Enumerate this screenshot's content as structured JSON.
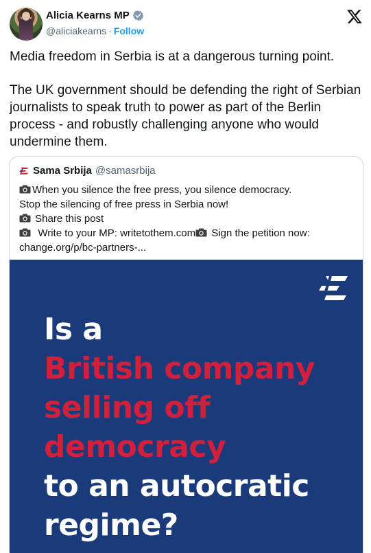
{
  "author": {
    "name": "Alicia Kearns MP",
    "handle": "@aliciakearns",
    "separator": "·",
    "follow_label": "Follow"
  },
  "platform": {
    "logo_icon": "x-logo-icon"
  },
  "tweet": {
    "paragraphs": [
      "Media freedom in Serbia is at a dangerous turning point.",
      "The UK government should be defending the right of Serbian journalists to speak truth to power as part of the Berlin process - and robustly challenging anyone who would undermine them."
    ]
  },
  "quoted": {
    "name": "Sama Srbija",
    "handle": "@samasrbija",
    "lines": [
      "When you silence the free press, you silence democracy.",
      "Stop the silencing of free press in Serbia now!",
      "Share this post",
      "Write to your MP: writetothem.com",
      "Sign the petition now:",
      "change.org/p/bc-partners-..."
    ],
    "image": {
      "background_color": "#1b3a7a",
      "white_color": "#ffffff",
      "red_color": "#d21f3c",
      "lines": [
        {
          "text": "Is a",
          "color": "white"
        },
        {
          "text": "British company",
          "color": "red"
        },
        {
          "text": "selling off",
          "color": "red"
        },
        {
          "text": "democracy",
          "color": "red"
        },
        {
          "text": "to an autocratic",
          "color": "white"
        },
        {
          "text": "regime?",
          "color": "white"
        }
      ]
    }
  },
  "colors": {
    "accent": "#1d9bf0",
    "text": "#0f1419",
    "muted": "#536471",
    "border": "#cfd9de"
  }
}
